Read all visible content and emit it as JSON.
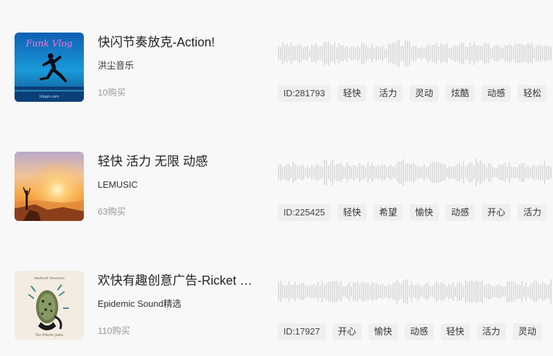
{
  "tracks": [
    {
      "title": "快闪节奏放克-Action!",
      "artist": "洪尘音乐",
      "sales": "10购买",
      "cover": {
        "text": "Funk Vlog",
        "watermark": "hibgm.com"
      },
      "id_tag": "ID:281793",
      "tags": [
        "轻快",
        "活力",
        "灵动",
        "炫酷",
        "动感",
        "轻松"
      ]
    },
    {
      "title": "轻快 活力 无限 动感",
      "artist": "LEMUSIC",
      "sales": "63购买",
      "cover": {},
      "id_tag": "ID:225425",
      "tags": [
        "轻快",
        "希望",
        "愉快",
        "动感",
        "开心",
        "活力"
      ]
    },
    {
      "title": "欢快有趣创意广告-Ricket Jackson",
      "artist": "Epidemic Sound精选",
      "sales": "110购买",
      "cover": {
        "top_text": "Ambush Sessions",
        "bottom_text": "The Whistle Jakes"
      },
      "id_tag": "ID:17927",
      "tags": [
        "开心",
        "愉快",
        "动感",
        "轻快",
        "活力",
        "灵动"
      ]
    }
  ],
  "colors": {
    "background": "#f8f8f8",
    "wave": "#c4c4c4",
    "tag_bg": "#efefef"
  }
}
